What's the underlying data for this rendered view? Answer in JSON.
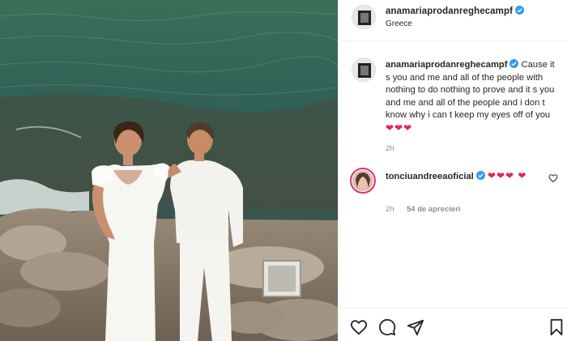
{
  "post": {
    "username": "anamariaprodanreghecampf",
    "verified": true,
    "location": "Greece"
  },
  "caption": {
    "username": "anamariaprodanreghecampf",
    "text": "Cause it s you and me and all of the people with nothing to do nothing to prove and it s you and me and all of the people and i don t know why i can t keep my eyes off of you",
    "emoji": "❤❤❤",
    "time": "2h"
  },
  "comments": [
    {
      "username": "tonciuandreeaoficial",
      "verified": true,
      "text": "❤❤❤ ❤",
      "time": "2h",
      "likes": "54 de aprecieri"
    }
  ],
  "icons": {
    "like": "heart-icon",
    "comment": "comment-icon",
    "share": "share-icon",
    "save": "bookmark-icon",
    "verified": "verified-badge-icon"
  },
  "colors": {
    "verified": "#3897f0",
    "heart": "#e0245e",
    "text": "#262626",
    "muted": "#8e8e8e",
    "divider": "#efefef"
  }
}
